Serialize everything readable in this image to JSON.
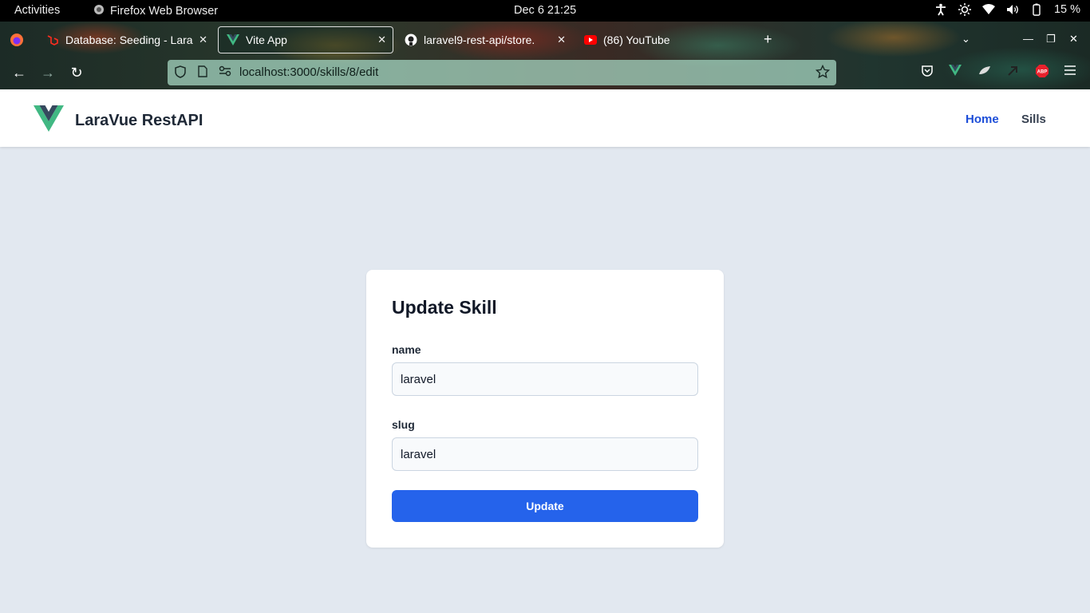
{
  "system_bar": {
    "activities": "Activities",
    "app_name": "Firefox Web Browser",
    "datetime": "Dec 6  21:25",
    "battery": "15 %"
  },
  "browser": {
    "tabs": [
      {
        "title": "Database: Seeding - Lara",
        "icon": "laravel-icon"
      },
      {
        "title": "Vite App",
        "icon": "vue-icon",
        "active": true
      },
      {
        "title": "laravel9-rest-api/store.",
        "icon": "github-icon"
      },
      {
        "title": "(86) YouTube",
        "icon": "youtube-icon"
      }
    ],
    "url": "localhost:3000/skills/8/edit"
  },
  "app": {
    "brand": "LaraVue RestAPI",
    "nav": {
      "home": "Home",
      "skills": "Sills"
    },
    "accent_color": "#2563eb"
  },
  "form": {
    "title": "Update Skill",
    "name_label": "name",
    "name_value": "laravel",
    "slug_label": "slug",
    "slug_value": "laravel",
    "submit": "Update"
  }
}
